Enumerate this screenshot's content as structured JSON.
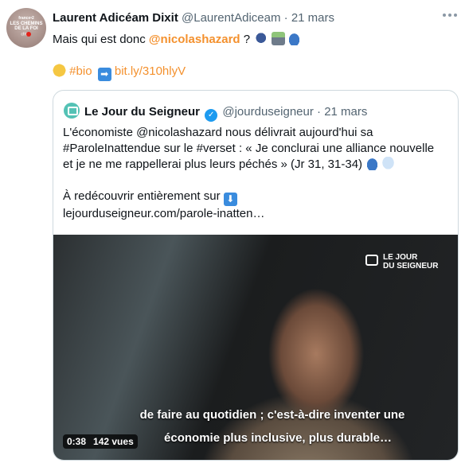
{
  "tweet": {
    "avatar": {
      "line1": "france•2",
      "line2": "LES CHEMINS DE LA FOI",
      "line3": "cfrt"
    },
    "author_name": "Laurent Adicéam Dixit",
    "handle": "@LaurentAdiceam",
    "separator": "·",
    "date": "21 mars",
    "text_prefix": "Mais qui est donc ",
    "mention": "@nicolashazard",
    "text_suffix": " ?",
    "emojis_line1": [
      "speaking-head",
      "motorway",
      "car"
    ],
    "line2": {
      "emoji": "thinking-face",
      "hashtag": "#bio",
      "arrow_emoji": "right-arrow",
      "link": "bit.ly/310hlyV"
    }
  },
  "quote": {
    "name": "Le Jour du Seigneur",
    "handle": "@jourduseigneur",
    "separator": "·",
    "date": "21 mars",
    "body_lines": [
      "L'économiste @nicolashazard nous délivrait aujourd'hui sa",
      "#ParoleInattendue sur le #verset : « Je conclurai une alliance nouvelle",
      "et je ne me rappellerai plus leurs péchés » (Jr 31, 31-34)"
    ],
    "body_line4": "À redécouvrir entièrement sur",
    "body_link": "lejourduseigneur.com/parole-inatten…",
    "video": {
      "logo_line1": "LE JOUR",
      "logo_line2": "DU SEIGNEUR",
      "subtitle_line1": "de faire au quotidien ; c'est-à-dire inventer une",
      "subtitle_line2": "économie plus inclusive, plus durable…",
      "duration": "0:38",
      "views": "142 vues"
    }
  },
  "colors": {
    "accent": "#f4912e",
    "muted": "#536471",
    "verified": "#1d9bf0",
    "logo": "#54c2b5"
  }
}
